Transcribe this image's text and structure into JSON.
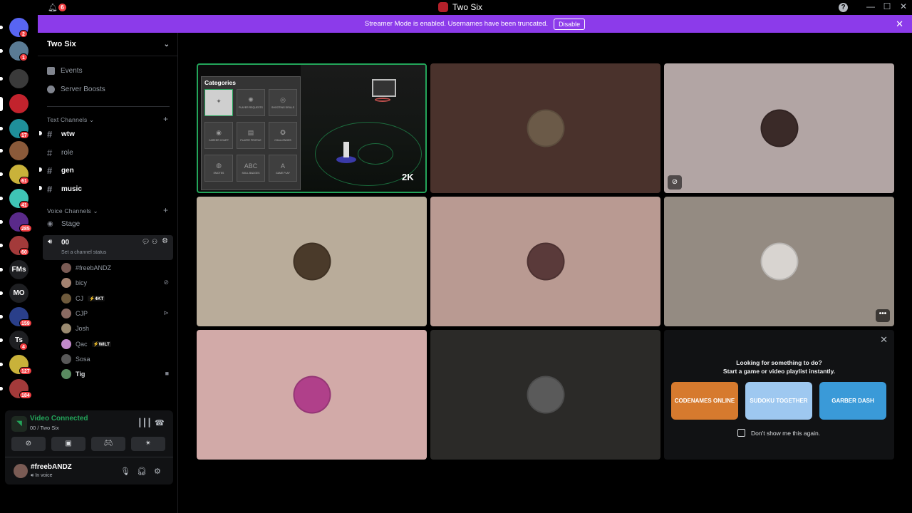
{
  "titlebar": {
    "title": "Two Six",
    "notification_count": "6",
    "help": "?",
    "minimize": "—",
    "maximize": "☐",
    "close": "✕"
  },
  "banner": {
    "text": "Streamer Mode is enabled. Usernames have been truncated.",
    "button": "Disable",
    "close": "✕"
  },
  "rail": {
    "servers": [
      {
        "label": "",
        "badge": "2",
        "color": "#5865f2"
      },
      {
        "label": "",
        "badge": "1",
        "color": "#5a7b94"
      },
      {
        "label": "",
        "badge": "",
        "color": "#3a3a3a"
      },
      {
        "label": "",
        "badge": "",
        "color": "#c2232d"
      },
      {
        "label": "",
        "badge": "17",
        "color": "#1f8f9a"
      },
      {
        "label": "",
        "badge": "",
        "color": "#8a5a3a"
      },
      {
        "label": "",
        "badge": "61",
        "color": "#c9b23a"
      },
      {
        "label": "",
        "badge": "41",
        "color": "#3fc4b5"
      },
      {
        "label": "",
        "badge": "285",
        "color": "#5a2a8a"
      },
      {
        "label": "",
        "badge": "60",
        "color": "#a33a3a"
      },
      {
        "label": "FMs",
        "badge": "",
        "color": "#1e1f22"
      },
      {
        "label": "MO",
        "badge": "",
        "color": "#1e1f22"
      },
      {
        "label": "",
        "badge": "159",
        "color": "#2a3f8a"
      },
      {
        "label": "Ts",
        "badge": "4",
        "color": "#1e1f22"
      },
      {
        "label": "",
        "badge": "127",
        "color": "#c9b23a"
      },
      {
        "label": "",
        "badge": "184",
        "color": "#a33a3a"
      }
    ]
  },
  "sidebar": {
    "guild_name": "Two Six",
    "events": "Events",
    "boosts": "Server Boosts",
    "text_category": "Text Channels",
    "text_channels": [
      {
        "name": "wtw",
        "unread": true
      },
      {
        "name": "role",
        "unread": false
      },
      {
        "name": "gen",
        "unread": true
      },
      {
        "name": "music",
        "unread": true
      }
    ],
    "voice_category": "Voice Channels",
    "stage_channel": "Stage",
    "active_voice": {
      "name": "00",
      "status": "Set a channel status"
    },
    "members": [
      {
        "name": "#freebANDZ",
        "tag": "",
        "color": "#7a5b54",
        "right": ""
      },
      {
        "name": "bicy",
        "tag": "",
        "color": "#a48270",
        "right": "⊘"
      },
      {
        "name": "CJ",
        "tag": "⚡4KT",
        "color": "#6e5a3c",
        "right": ""
      },
      {
        "name": "CJP",
        "tag": "",
        "color": "#8a6a62",
        "right": "⊳"
      },
      {
        "name": "Josh",
        "tag": "",
        "color": "#9a8a70",
        "right": ""
      },
      {
        "name": "Qac",
        "tag": "⚡WILT",
        "color": "#c28acb",
        "right": ""
      },
      {
        "name": "Sosa",
        "tag": "",
        "color": "#585858",
        "right": ""
      },
      {
        "name": "Tig",
        "tag": "",
        "color": "#5a8a60",
        "right": "■"
      }
    ]
  },
  "voice_panel": {
    "status": "Video Connected",
    "channel": "00 / Two Six",
    "user": "#freebANDZ",
    "user_status": "In voice"
  },
  "game": {
    "categories_title": "Categories",
    "cells": [
      {
        "glyph": "✦",
        "caption": "",
        "selected": true
      },
      {
        "glyph": "✺",
        "caption": "PLAYER REQUESTS",
        "selected": false
      },
      {
        "glyph": "◎",
        "caption": "SHOOTING DRILLS",
        "selected": false
      },
      {
        "glyph": "◉",
        "caption": "CAREER COURT",
        "selected": false
      },
      {
        "glyph": "▤",
        "caption": "PLAYER PROFILE",
        "selected": false
      },
      {
        "glyph": "✪",
        "caption": "CHALLENGES",
        "selected": false
      },
      {
        "glyph": "◍",
        "caption": "EMOTES",
        "selected": false
      },
      {
        "glyph": "ABC",
        "caption": "SKILL BADGES",
        "selected": false
      },
      {
        "glyph": "A",
        "caption": "GAME PLAY",
        "selected": false
      }
    ]
  },
  "tiles": [
    {
      "bg": "#4a322c",
      "avatar": "#6b5a48",
      "muted": false,
      "more": false
    },
    {
      "bg": "#b2a5a4",
      "avatar": "#3a2a28",
      "muted": true,
      "more": false
    },
    {
      "bg": "#b9ac9a",
      "avatar": "#4a3a2a",
      "muted": false,
      "more": false
    },
    {
      "bg": "#b99a92",
      "avatar": "#5a3a3a",
      "muted": false,
      "more": false
    },
    {
      "bg": "#948b82",
      "avatar": "#d8d4d0",
      "muted": false,
      "more": true
    },
    {
      "bg": "#d2aaa8",
      "avatar": "#b0408a",
      "muted": false,
      "more": false
    },
    {
      "bg": "#2b2a28",
      "avatar": "#5a5a5a",
      "muted": false,
      "more": false
    }
  ],
  "activity": {
    "line1": "Looking for something to do?",
    "line2": "Start a game or video playlist instantly.",
    "cards": [
      {
        "title": "CODENAMES ONLINE",
        "bg": "#d67a2e"
      },
      {
        "title": "SUDOKU TOGETHER",
        "bg": "#9ec8f0"
      },
      {
        "title": "GARBER DASH",
        "bg": "#3a9ad8"
      }
    ],
    "dont_show": "Don't show me this again."
  }
}
